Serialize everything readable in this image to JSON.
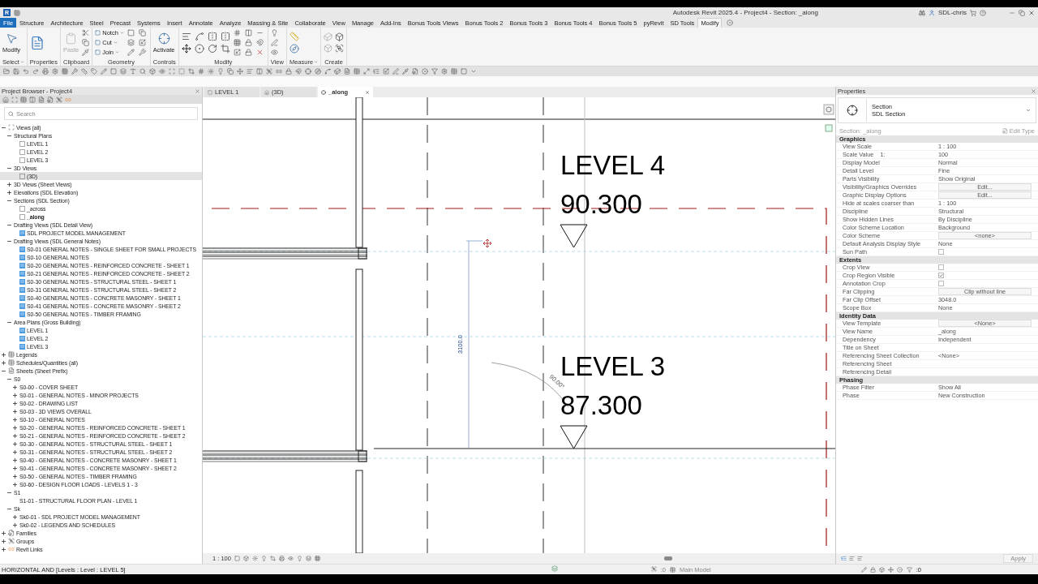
{
  "window": {
    "logo": "R",
    "title": "Autodesk Revit 2025.4 - Project4 - Section: _along",
    "user": "SDL-chris"
  },
  "ribbon_tabs": [
    {
      "label": "File",
      "kind": "file",
      "selected": false
    },
    {
      "label": "Structure",
      "kind": "tab",
      "selected": false
    },
    {
      "label": "Architecture",
      "kind": "tab",
      "selected": false
    },
    {
      "label": "Steel",
      "kind": "tab",
      "selected": false
    },
    {
      "label": "Precast",
      "kind": "tab",
      "selected": false
    },
    {
      "label": "Systems",
      "kind": "tab",
      "selected": false
    },
    {
      "label": "Insert",
      "kind": "tab",
      "selected": false
    },
    {
      "label": "Annotate",
      "kind": "tab",
      "selected": false
    },
    {
      "label": "Analyze",
      "kind": "tab",
      "selected": false
    },
    {
      "label": "Massing & Site",
      "kind": "tab",
      "selected": false
    },
    {
      "label": "Collaborate",
      "kind": "tab",
      "selected": false
    },
    {
      "label": "View",
      "kind": "tab",
      "selected": false
    },
    {
      "label": "Manage",
      "kind": "tab",
      "selected": false
    },
    {
      "label": "Add-Ins",
      "kind": "tab",
      "selected": false
    },
    {
      "label": "Bonus Tools Views",
      "kind": "tab",
      "selected": false
    },
    {
      "label": "Bonus Tools 2",
      "kind": "tab",
      "selected": false
    },
    {
      "label": "Bonus Tools 3",
      "kind": "tab",
      "selected": false
    },
    {
      "label": "Bonus Tools 4",
      "kind": "tab",
      "selected": false
    },
    {
      "label": "Bonus Tools 5",
      "kind": "tab",
      "selected": false
    },
    {
      "label": "pyRevit",
      "kind": "tab",
      "selected": false
    },
    {
      "label": "SD Tools",
      "kind": "tab",
      "selected": false
    },
    {
      "label": "Modify",
      "kind": "tab",
      "selected": true
    }
  ],
  "ribbon_panels": [
    {
      "title": "Select",
      "kind": "select",
      "menu": true,
      "tools": [
        {
          "label": "Modify",
          "disabled": false
        }
      ]
    },
    {
      "title": "Properties",
      "kind": "properties",
      "menu": false
    },
    {
      "title": "Clipboard",
      "kind": "clipboard",
      "menu": false,
      "tools": [
        {
          "label": "Paste",
          "disabled": true
        }
      ]
    },
    {
      "title": "Geometry",
      "kind": "geometry",
      "menu": false,
      "tools": [
        {
          "label": "Notch",
          "disabled": false
        },
        {
          "label": "Cut",
          "disabled": false
        },
        {
          "label": "Join",
          "disabled": false
        }
      ]
    },
    {
      "title": "Controls",
      "kind": "controls",
      "menu": false,
      "tools": [
        {
          "label": "Activate",
          "disabled": false
        }
      ]
    },
    {
      "title": "Modify",
      "kind": "modify",
      "menu": false
    },
    {
      "title": "View",
      "kind": "view",
      "menu": false
    },
    {
      "title": "Measure",
      "kind": "measure",
      "menu": true
    },
    {
      "title": "Create",
      "kind": "create",
      "menu": false
    }
  ],
  "view_tabs": [
    {
      "label": "LEVEL 1",
      "kind": "plan",
      "selected": false
    },
    {
      "label": "(3D)",
      "kind": "model",
      "selected": false
    },
    {
      "label": "_along",
      "kind": "section",
      "selected": true
    }
  ],
  "project_browser": {
    "title": "Project Browser - Project4",
    "search": {
      "placeholder": "Search"
    },
    "tree": [
      {
        "label": "Views (all)",
        "kind": "views",
        "expanded": true,
        "selected": false,
        "children": [
          {
            "label": "Structural Plans",
            "expanded": true,
            "selected": false,
            "children": [
              {
                "label": "LEVEL 1",
                "kind": "view",
                "selected": false
              },
              {
                "label": "LEVEL 2",
                "kind": "view",
                "selected": false
              },
              {
                "label": "LEVEL 3",
                "kind": "view",
                "selected": false
              }
            ]
          },
          {
            "label": "3D Views",
            "expanded": true,
            "selected": false,
            "children": [
              {
                "label": "(3D)",
                "kind": "view",
                "selected": true
              }
            ]
          },
          {
            "label": "3D Views (Sheet Views)",
            "expanded": false,
            "selected": false
          },
          {
            "label": "Elevations (SDL Elevation)",
            "expanded": false,
            "selected": false
          },
          {
            "label": "Sections (SDL Section)",
            "expanded": true,
            "selected": false,
            "children": [
              {
                "label": "_across",
                "kind": "view",
                "selected": false,
                "current": false
              },
              {
                "label": "_along",
                "kind": "view",
                "selected": false,
                "current": true
              }
            ]
          },
          {
            "label": "Drafting Views (SDL Detail View)",
            "expanded": true,
            "selected": false,
            "children": [
              {
                "label": "SDL PROJECT MODEL MANAGEMENT",
                "kind": "drafting",
                "selected": false
              }
            ]
          },
          {
            "label": "Drafting Views (SDL General Notes)",
            "expanded": true,
            "selected": false,
            "children": [
              {
                "label": "S0-01 GENERAL NOTES - SINGLE SHEET FOR SMALL PROJECTS",
                "kind": "drafting",
                "selected": false
              },
              {
                "label": "S0-10 GENERAL NOTES",
                "kind": "drafting",
                "selected": false
              },
              {
                "label": "S0-20 GENERAL NOTES - REINFORCED CONCRETE - SHEET 1",
                "kind": "drafting",
                "selected": false
              },
              {
                "label": "S0-21 GENERAL NOTES - REINFORCED CONCRETE - SHEET 2",
                "kind": "drafting",
                "selected": false
              },
              {
                "label": "S0-30 GENERAL NOTES - STRUCTURAL STEEL - SHEET 1",
                "kind": "drafting",
                "selected": false
              },
              {
                "label": "S0-31 GENERAL NOTES - STRUCTURAL STEEL - SHEET 2",
                "kind": "drafting",
                "selected": false
              },
              {
                "label": "S0-40 GENERAL NOTES - CONCRETE MASONRY - SHEET 1",
                "kind": "drafting",
                "selected": false
              },
              {
                "label": "S0-41 GENERAL NOTES - CONCRETE MASONRY - SHEET 2",
                "kind": "drafting",
                "selected": false
              },
              {
                "label": "S0-50 GENERAL NOTES - TIMBER FRAMING",
                "kind": "drafting",
                "selected": false
              }
            ]
          },
          {
            "label": "Area Plans (Gross Building)",
            "expanded": true,
            "selected": false,
            "children": [
              {
                "label": "LEVEL 1",
                "kind": "drafting",
                "selected": false
              },
              {
                "label": "LEVEL 2",
                "kind": "drafting",
                "selected": false
              },
              {
                "label": "LEVEL 3",
                "kind": "drafting",
                "selected": false
              }
            ]
          }
        ]
      },
      {
        "label": "Legends",
        "kind": "legends",
        "expanded": false,
        "selected": false
      },
      {
        "label": "Schedules/Quantities (all)",
        "kind": "schedules",
        "expanded": false,
        "selected": false
      },
      {
        "label": "Sheets (Sheet Prefix)",
        "kind": "sheets",
        "expanded": true,
        "selected": false,
        "children": [
          {
            "label": "S0",
            "expanded": true,
            "selected": false,
            "children": [
              {
                "label": "S0-00 - COVER SHEET",
                "kind": "sheet",
                "expanded": false,
                "selected": false
              },
              {
                "label": "S0-01 - GENERAL NOTES - MINOR PROJECTS",
                "kind": "sheet",
                "expanded": false,
                "selected": false
              },
              {
                "label": "S0-02 - DRAWING LIST",
                "kind": "sheet",
                "expanded": false,
                "selected": false
              },
              {
                "label": "S0-03 - 3D VIEWS OVERALL",
                "kind": "sheet",
                "expanded": false,
                "selected": false
              },
              {
                "label": "S0-10 - GENERAL NOTES",
                "kind": "sheet",
                "expanded": false,
                "selected": false
              },
              {
                "label": "S0-20 - GENERAL NOTES - REINFORCED CONCRETE - SHEET 1",
                "kind": "sheet",
                "expanded": false,
                "selected": false
              },
              {
                "label": "S0-21 - GENERAL NOTES - REINFORCED CONCRETE - SHEET 2",
                "kind": "sheet",
                "expanded": false,
                "selected": false
              },
              {
                "label": "S0-30 - GENERAL NOTES - STRUCTURAL STEEL - SHEET 1",
                "kind": "sheet",
                "expanded": false,
                "selected": false
              },
              {
                "label": "S0-31 - GENERAL NOTES - STRUCTURAL STEEL - SHEET 2",
                "kind": "sheet",
                "expanded": false,
                "selected": false
              },
              {
                "label": "S0-40 - GENERAL NOTES - CONCRETE MASONRY - SHEET 1",
                "kind": "sheet",
                "expanded": false,
                "selected": false
              },
              {
                "label": "S0-41 - GENERAL NOTES - CONCRETE MASONRY - SHEET 2",
                "kind": "sheet",
                "expanded": false,
                "selected": false
              },
              {
                "label": "S0-50 - GENERAL NOTES - TIMBER FRAMING",
                "kind": "sheet",
                "expanded": false,
                "selected": false
              },
              {
                "label": "S0-60 - DESIGN FLOOR LOADS - LEVELS 1 - 3",
                "kind": "sheet",
                "expanded": false,
                "selected": false
              }
            ]
          },
          {
            "label": "S1",
            "expanded": true,
            "selected": false,
            "children": [
              {
                "label": "S1-01 - STRUCTURAL FLOOR PLAN - LEVEL 1",
                "kind": "sheet",
                "selected": false
              }
            ]
          },
          {
            "label": "Sk",
            "expanded": true,
            "selected": false,
            "children": [
              {
                "label": "Sk0-01 - SDL PROJECT MODEL MANAGEMENT",
                "kind": "sheet",
                "expanded": false,
                "selected": false
              },
              {
                "label": "Sk0-02 - LEGENDS AND SCHEDULES",
                "kind": "sheet",
                "expanded": false,
                "selected": false
              }
            ]
          }
        ]
      },
      {
        "label": "Families",
        "kind": "families",
        "expanded": false,
        "selected": false
      },
      {
        "label": "Groups",
        "kind": "groups",
        "expanded": false,
        "selected": false
      },
      {
        "label": "Revit Links",
        "kind": "links",
        "expanded": false,
        "selected": false
      }
    ]
  },
  "canvas": {
    "levels": [
      {
        "name": "LEVEL 4",
        "elevation": "90.300"
      },
      {
        "name": "LEVEL 3",
        "elevation": "87.300"
      }
    ],
    "dimension": "3100.0",
    "angle": "90.00°",
    "scale": "1 : 100"
  },
  "properties": {
    "title": "Properties",
    "type_category": "Section",
    "type_name": "SDL Section",
    "instance": "Section: _along",
    "edit_type": "Edit Type",
    "groups": [
      {
        "name": "Graphics",
        "rows": [
          {
            "label": "View Scale",
            "kind": "text",
            "value": "1 : 100"
          },
          {
            "label": "Scale Value    1:",
            "kind": "text",
            "value": "100"
          },
          {
            "label": "Display Model",
            "kind": "text",
            "value": "Normal"
          },
          {
            "label": "Detail Level",
            "kind": "text",
            "value": "Fine"
          },
          {
            "label": "Parts Visibility",
            "kind": "text",
            "value": "Show Original"
          },
          {
            "label": "Visibility/Graphics Overrides",
            "kind": "button",
            "value": "Edit..."
          },
          {
            "label": "Graphic Display Options",
            "kind": "button",
            "value": "Edit..."
          },
          {
            "label": "Hide at scales coarser than",
            "kind": "text",
            "value": "1 : 100"
          },
          {
            "label": "Discipline",
            "kind": "text",
            "value": "Structural"
          },
          {
            "label": "Show Hidden Lines",
            "kind": "text",
            "value": "By Discipline"
          },
          {
            "label": "Color Scheme Location",
            "kind": "text",
            "value": "Background"
          },
          {
            "label": "Color Scheme",
            "kind": "button",
            "value": "<none>"
          },
          {
            "label": "Default Analysis Display Style",
            "kind": "text",
            "value": "None"
          },
          {
            "label": "Sun Path",
            "kind": "checkbox",
            "checked": false
          }
        ]
      },
      {
        "name": "Extents",
        "rows": [
          {
            "label": "Crop View",
            "kind": "checkbox",
            "checked": false
          },
          {
            "label": "Crop Region Visible",
            "kind": "checkbox",
            "checked": true
          },
          {
            "label": "Annotation Crop",
            "kind": "checkbox",
            "checked": false
          },
          {
            "label": "Far Clipping",
            "kind": "button",
            "value": "Clip without line"
          },
          {
            "label": "Far Clip Offset",
            "kind": "text",
            "value": "3048.0"
          },
          {
            "label": "Scope Box",
            "kind": "text",
            "value": "None"
          }
        ]
      },
      {
        "name": "Identity Data",
        "rows": [
          {
            "label": "View Template",
            "kind": "button",
            "value": "<None>"
          },
          {
            "label": "View Name",
            "kind": "text",
            "value": "_along"
          },
          {
            "label": "Dependency",
            "kind": "text",
            "value": "Independent"
          },
          {
            "label": "Title on Sheet",
            "kind": "text"
          },
          {
            "label": "Referencing Sheet Collection",
            "kind": "text",
            "value": "<None>"
          },
          {
            "label": "Referencing Sheet",
            "kind": "text"
          },
          {
            "label": "Referencing Detail",
            "kind": "text"
          }
        ]
      },
      {
        "name": "Phasing",
        "rows": [
          {
            "label": "Phase Filter",
            "kind": "text",
            "value": "Show All"
          },
          {
            "label": "Phase",
            "kind": "text",
            "value": "New Construction"
          }
        ]
      }
    ],
    "apply": {
      "label": "Apply",
      "disabled": true
    }
  },
  "status_bar": {
    "message": "HORIZONTAL AND [Levels : Level : LEVEL 5]",
    "workset_count": ":0",
    "design_option": "Main Model",
    "filter_count": ":0"
  }
}
